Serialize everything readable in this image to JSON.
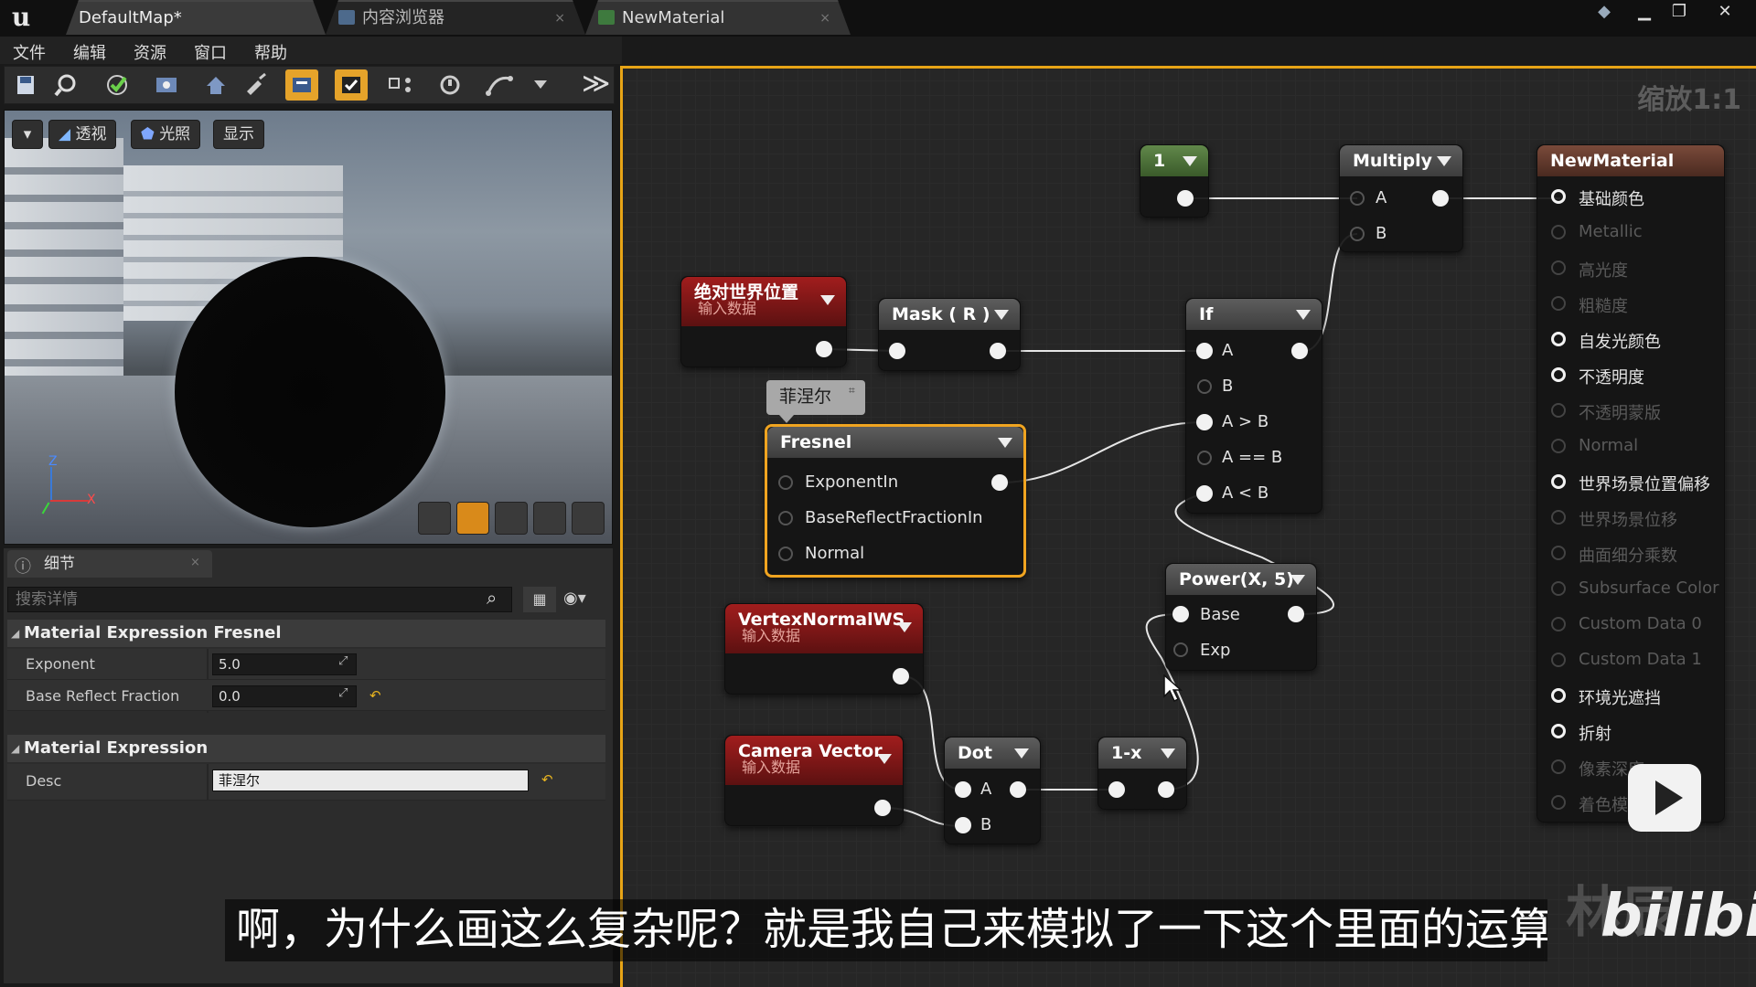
{
  "titlebar": {
    "tabs": [
      {
        "label": "DefaultMap*"
      },
      {
        "label": "内容浏览器"
      },
      {
        "label": "NewMaterial"
      }
    ]
  },
  "menu": [
    "文件",
    "编辑",
    "资源",
    "窗口",
    "帮助"
  ],
  "viewport": {
    "buttons": [
      "透视",
      "光照",
      "显示"
    ],
    "axis_z": "Z",
    "axis_x": "X"
  },
  "details": {
    "tab_label": "细节",
    "search_placeholder": "搜索详情",
    "section1": "Material Expression Fresnel",
    "exponent_label": "Exponent",
    "exponent_value": "5.0",
    "brf_label": "Base Reflect Fraction",
    "brf_value": "0.0",
    "section2": "Material Expression",
    "desc_label": "Desc",
    "desc_value": "菲涅尔"
  },
  "graph": {
    "zoom": "缩放1:1",
    "comment": "菲涅尔",
    "nodes": {
      "const1": {
        "title": "1"
      },
      "multiply": {
        "title": "Multiply",
        "pins": [
          "A",
          "B"
        ]
      },
      "absworld": {
        "title": "绝对世界位置",
        "sub": "输入数据"
      },
      "mask": {
        "title": "Mask ( R )"
      },
      "if": {
        "title": "If",
        "pins": [
          "A",
          "B",
          "A > B",
          "A == B",
          "A < B"
        ]
      },
      "fresnel": {
        "title": "Fresnel",
        "pins": [
          "ExponentIn",
          "BaseReflectFractionIn",
          "Normal"
        ]
      },
      "power": {
        "title": "Power(X, 5)",
        "pins": [
          "Base",
          "Exp"
        ]
      },
      "vertexnormal": {
        "title": "VertexNormalWS",
        "sub": "输入数据"
      },
      "camera": {
        "title": "Camera Vector",
        "sub": "输入数据"
      },
      "dot": {
        "title": "Dot",
        "pins": [
          "A",
          "B"
        ]
      },
      "oneminus": {
        "title": "1-x"
      },
      "material": {
        "title": "NewMaterial",
        "pins": [
          {
            "label": "基础颜色",
            "active": true
          },
          {
            "label": "Metallic",
            "active": false
          },
          {
            "label": "高光度",
            "active": false
          },
          {
            "label": "粗糙度",
            "active": false
          },
          {
            "label": "自发光颜色",
            "active": true
          },
          {
            "label": "不透明度",
            "active": true
          },
          {
            "label": "不透明蒙版",
            "active": false
          },
          {
            "label": "Normal",
            "active": false
          },
          {
            "label": "世界场景位置偏移",
            "active": true
          },
          {
            "label": "世界场景位移",
            "active": false
          },
          {
            "label": "曲面细分乘数",
            "active": false
          },
          {
            "label": "Subsurface Color",
            "active": false
          },
          {
            "label": "Custom Data 0",
            "active": false
          },
          {
            "label": "Custom Data 1",
            "active": false
          },
          {
            "label": "环境光遮挡",
            "active": true
          },
          {
            "label": "折射",
            "active": true
          },
          {
            "label": "像素深度",
            "active": false
          },
          {
            "label": "着色模",
            "active": false
          }
        ]
      }
    }
  },
  "overlay": {
    "subtitle": "啊，为什么画这么复杂呢？就是我自己来模拟了一下这个里面的运算",
    "watermark": "林辰",
    "brand": "bilibili"
  },
  "colors": {
    "accent": "#e7a416",
    "node_red": "#a11d1d",
    "node_green": "#61884a",
    "node_gray": "#5d5d5d"
  }
}
